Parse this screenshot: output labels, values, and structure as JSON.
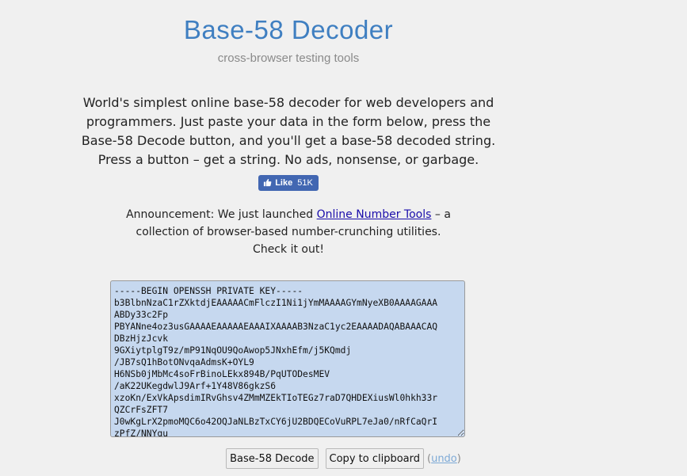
{
  "header": {
    "title": "Base-58 Decoder",
    "subtitle": "cross-browser testing tools"
  },
  "intro": {
    "text": "World's simplest online base-58 decoder for web developers and programmers. Just paste your data in the form below, press the Base-58 Decode button, and you'll get a base-58 decoded string. Press a button – get a string. No ads, nonsense, or garbage."
  },
  "facebook": {
    "like_label": "Like",
    "count": "51K",
    "color": "#4267b2"
  },
  "announcement": {
    "label": "Announcement",
    "text_before": ": We just launched ",
    "link_text": "Online Number Tools",
    "text_after": " – a collection of browser-based number-crunching utilities. Check it out!"
  },
  "editor": {
    "value": "-----BEGIN OPENSSH PRIVATE KEY-----\nb3BlbnNzaC1rZXktdjEAAAAACmFlczI1Ni1jYmMAAAAGYmNyeXB0AAAAGAAA\nABDy33c2Fp\nPBYANne4oz3usGAAAAEAAAAAEAAAIXAAAAB3NzaC1yc2EAAAADAQABAAACAQ\nDBzHjzJcvk\n9GXiytplgT9z/mP91NqOU9QoAwop5JNxhEfm/j5KQmdj\n/JB7sQ1hBotONvqaAdmsK+OYL9\nH6NSb0jMbMc4soFrBinoLEkx894B/PqUTODesMEV\n/aK22UKegdwlJ9Arf+1Y48V86gkzS6\nxzoKn/ExVkApsdimIRvGhsv4ZMmMZEkTIoTEGz7raD7QHDEXiusWl0hkh33r\nQZCrFsZFT7\nJ0wKgLrX2pmoMQC6o42OQJaNLBzTxCY6jU2BDQECoVuRPL7eJa0/nRfCaQrI\nzPfZ/NNYqu",
    "bg_color": "#c6d8ef"
  },
  "actions": {
    "decode_label": "Base-58 Decode",
    "copy_label": "Copy to clipboard",
    "undo_open": "(",
    "undo_label": "undo",
    "undo_close": ")"
  },
  "colors": {
    "page_bg": "#f0f0f0",
    "title": "#3f7fc1",
    "link": "#1a0dab"
  }
}
